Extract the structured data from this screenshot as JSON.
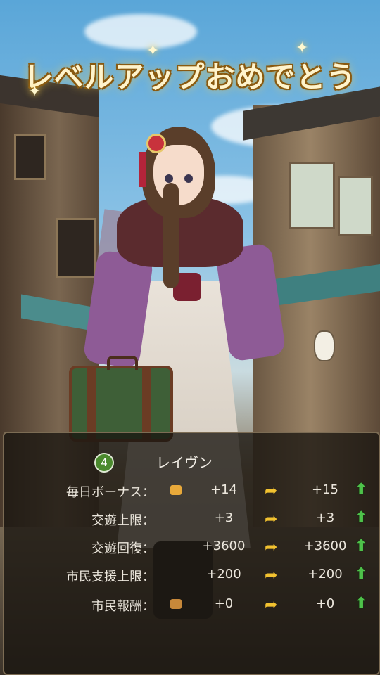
{
  "title": "レベルアップおめでとう",
  "character": {
    "level": "4",
    "name": "レイヴン"
  },
  "stats": [
    {
      "label": "毎日ボーナス：",
      "icon": "coin-pouch-icon",
      "before": "+14",
      "after": "+15",
      "increased": true
    },
    {
      "label": "交遊上限：",
      "icon": "",
      "before": "+3",
      "after": "+3",
      "increased": true
    },
    {
      "label": "交遊回復：",
      "icon": "",
      "before": "+3600",
      "after": "+3600",
      "increased": true
    },
    {
      "label": "市民支援上限：",
      "icon": "",
      "before": "+200",
      "after": "+200",
      "increased": true
    },
    {
      "label": "市民報酬：",
      "icon": "reward-chest-icon",
      "before": "+0",
      "after": "+0",
      "increased": true
    }
  ],
  "colors": {
    "title_glow": "#ffd24a",
    "panel_bg": "#181410",
    "arrow": "#f2c230",
    "up_arrow": "#4ec24a",
    "level_badge": "#4b8a2e"
  }
}
